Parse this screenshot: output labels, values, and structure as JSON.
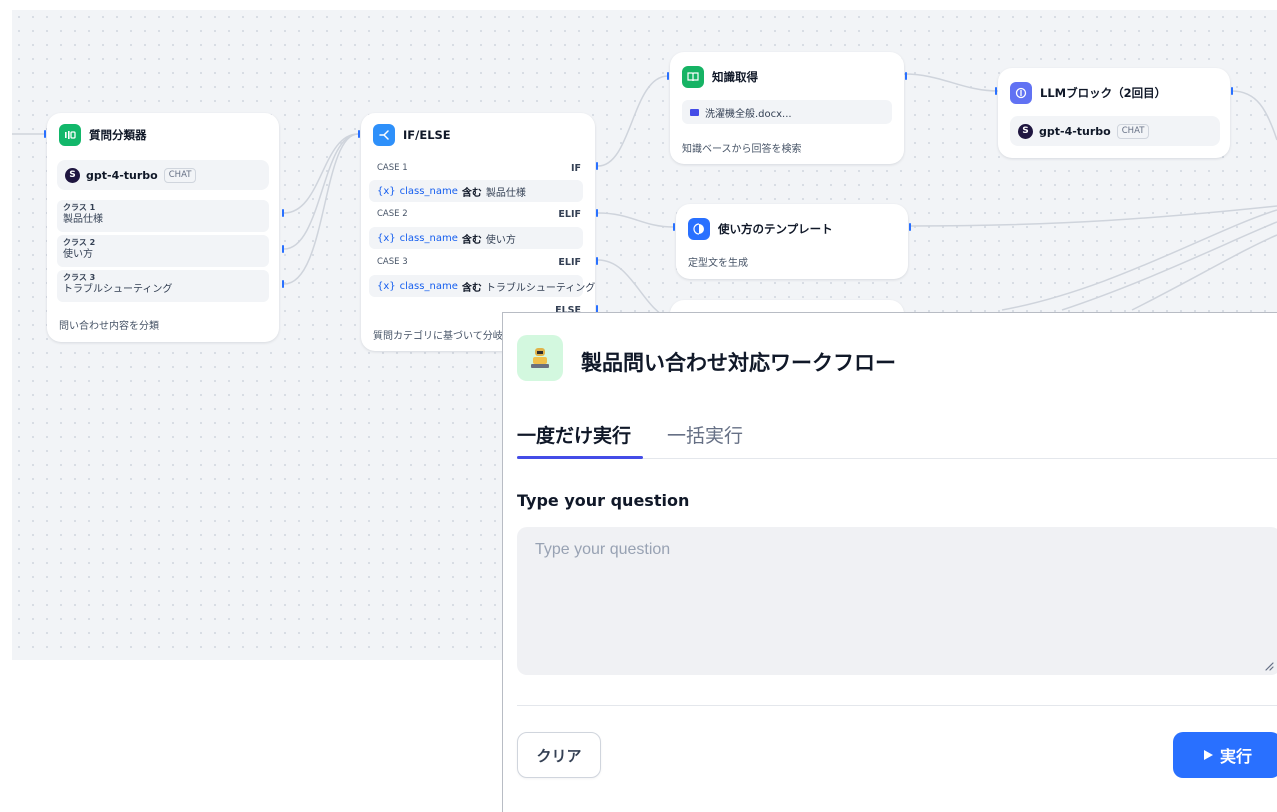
{
  "canvas": {
    "classifier": {
      "title": "質問分類器",
      "model": {
        "name": "gpt-4-turbo",
        "tag": "CHAT"
      },
      "classes": [
        {
          "key": "クラス 1",
          "value": "製品仕様"
        },
        {
          "key": "クラス 2",
          "value": "使い方"
        },
        {
          "key": "クラス 3",
          "value": "トラブルシューティング"
        }
      ],
      "description": "問い合わせ内容を分類"
    },
    "ifelse": {
      "title": "IF/ELSE",
      "cases": [
        {
          "label": "CASE 1",
          "keyword": "IF",
          "variable": "class_name",
          "operator": "含む",
          "value": "製品仕様"
        },
        {
          "label": "CASE 2",
          "keyword": "ELIF",
          "variable": "class_name",
          "operator": "含む",
          "value": "使い方"
        },
        {
          "label": "CASE 3",
          "keyword": "ELIF",
          "variable": "class_name",
          "operator": "含む",
          "value": "トラブルシューティング"
        }
      ],
      "else_label": "ELSE",
      "var_prefix": "{x}",
      "description": "質問カテゴリに基づいて分岐"
    },
    "knowledge": {
      "title": "知識取得",
      "file": "洗濯機全般.docx...",
      "description": "知識ベースから回答を検索"
    },
    "template": {
      "title": "使い方のテンプレート",
      "description": "定型文を生成"
    },
    "llm": {
      "title": "LLMブロック（2回目）",
      "model": {
        "name": "gpt-4-turbo",
        "tag": "CHAT"
      }
    }
  },
  "panel": {
    "app_title": "製品問い合わせ対応ワークフロー",
    "tabs": [
      "一度だけ実行",
      "一括実行"
    ],
    "field_label": "Type your question",
    "field_placeholder": "Type your question",
    "field_value": "",
    "clear_label": "クリア",
    "run_label": "実行"
  },
  "colors": {
    "accent": "#2970ff",
    "tab_underline": "#444ce7",
    "classifier_icon": "#12b76a",
    "ifelse_icon": "#2e90fa",
    "knowledge_icon": "#16b364",
    "template_icon": "#2970ff",
    "llm_icon": "#6172f3"
  },
  "icons": {
    "classifier": "question-classifier-icon",
    "ifelse": "branch-icon",
    "knowledge": "book-icon",
    "template": "template-icon",
    "llm": "llm-brain-icon",
    "run": "play-icon"
  }
}
